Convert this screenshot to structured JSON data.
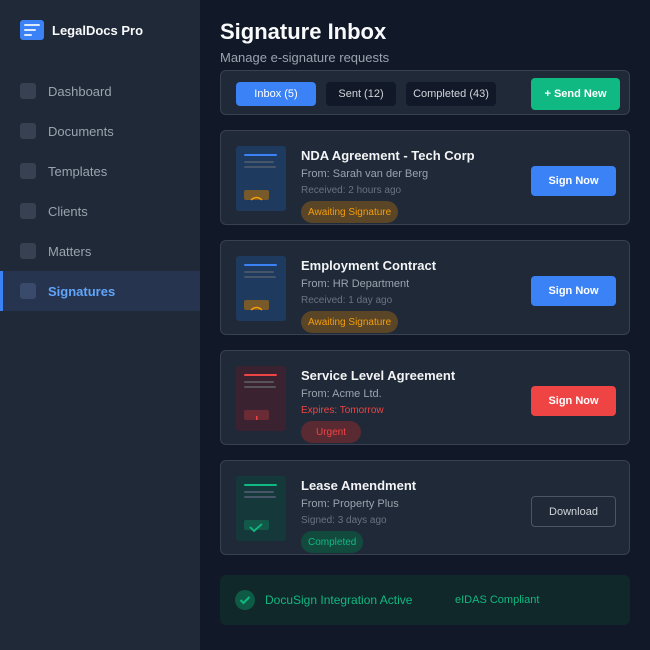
{
  "app": {
    "name": "LegalDocs Pro",
    "logo_icon": "document-lines-icon"
  },
  "sidebar": {
    "items": [
      {
        "label": "Dashboard",
        "active": false
      },
      {
        "label": "Documents",
        "active": false
      },
      {
        "label": "Templates",
        "active": false
      },
      {
        "label": "Clients",
        "active": false
      },
      {
        "label": "Matters",
        "active": false
      },
      {
        "label": "Signatures",
        "active": true
      }
    ]
  },
  "header": {
    "title": "Signature Inbox",
    "subtitle": "Manage e-signature requests"
  },
  "tabs": [
    {
      "label": "Inbox (5)",
      "active": true
    },
    {
      "label": "Sent (12)",
      "active": false
    },
    {
      "label": "Completed (43)",
      "active": false
    }
  ],
  "send_button": "+ Send New",
  "documents": [
    {
      "title": "NDA Agreement - Tech Corp",
      "from": "From: Sarah van der Berg",
      "meta": "Received: 2 hours ago",
      "badge": "Awaiting Signature",
      "action": "Sign Now",
      "status": "awaiting"
    },
    {
      "title": "Employment Contract",
      "from": "From: HR Department",
      "meta": "Received: 1 day ago",
      "badge": "Awaiting Signature",
      "action": "Sign Now",
      "status": "awaiting"
    },
    {
      "title": "Service Level Agreement",
      "from": "From: Acme Ltd.",
      "meta": "Expires: Tomorrow",
      "badge": "Urgent",
      "action": "Sign Now",
      "status": "urgent"
    },
    {
      "title": "Lease Amendment",
      "from": "From: Property Plus",
      "meta": "Signed: 3 days ago",
      "badge": "Completed",
      "action": "Download",
      "status": "completed"
    }
  ],
  "footer": {
    "integration": "DocuSign Integration Active",
    "compliance": "eIDAS Compliant",
    "icon": "check-circle-icon"
  },
  "colors": {
    "accent": "#3b82f6",
    "success": "#10b981",
    "warning": "#f59e0b",
    "danger": "#ef4444"
  }
}
